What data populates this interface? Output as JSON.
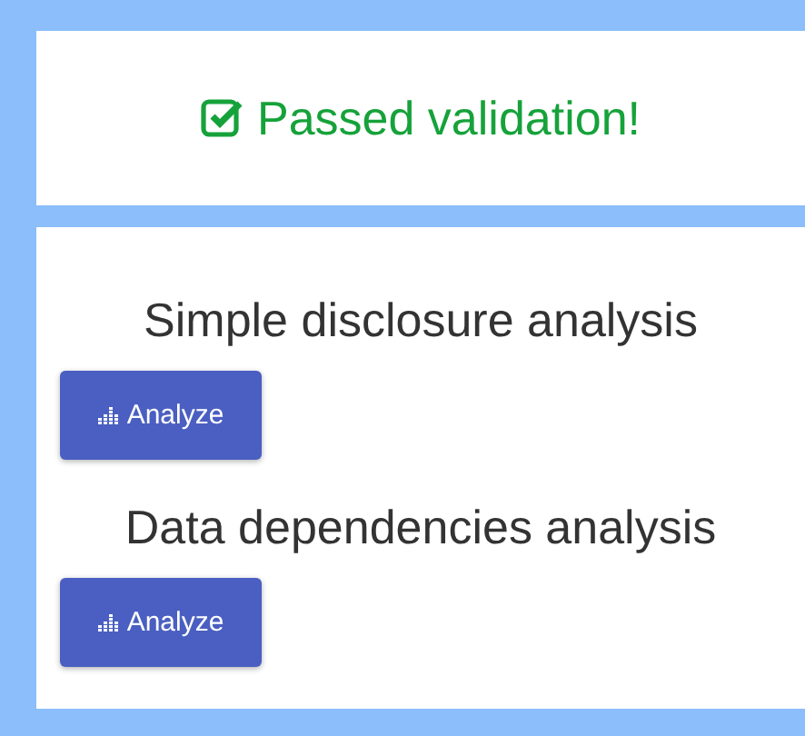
{
  "validation": {
    "message": "Passed validation!",
    "passed": true
  },
  "analyses": [
    {
      "title": "Simple disclosure analysis",
      "button": "Analyze"
    },
    {
      "title": "Data dependencies analysis",
      "button": "Analyze"
    }
  ]
}
